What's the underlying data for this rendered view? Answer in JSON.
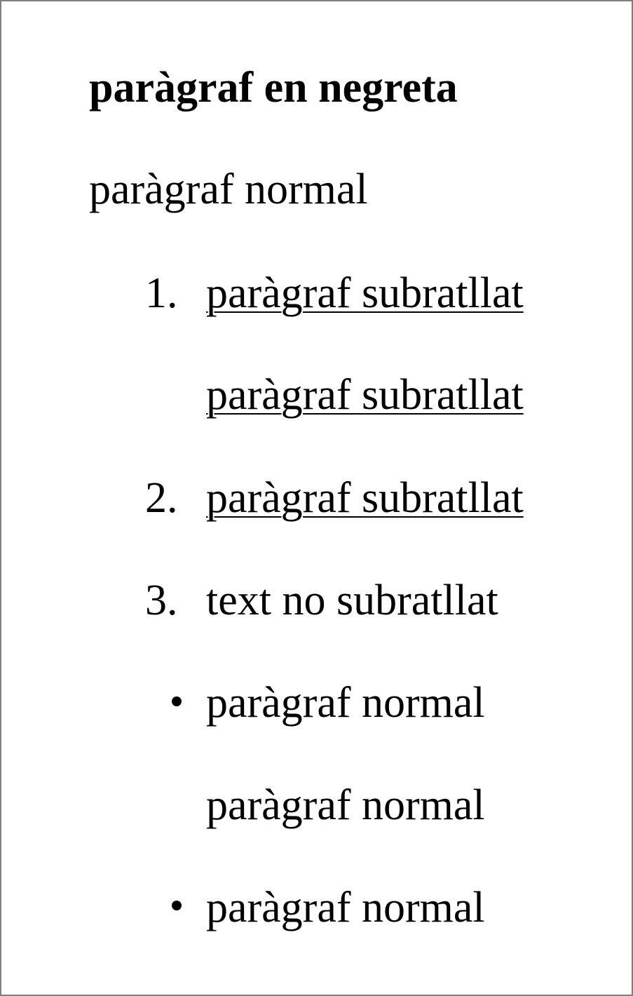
{
  "document": {
    "paragraphs": [
      {
        "text": "paràgraf en negreta",
        "bold": true
      },
      {
        "text": "paràgraf normal",
        "bold": false
      }
    ],
    "ordered_list": [
      {
        "marker": "1.",
        "lines": [
          "paràgraf subratllat",
          "paràgraf subratllat"
        ],
        "underline": true
      },
      {
        "marker": "2.",
        "lines": [
          "paràgraf subratllat"
        ],
        "underline": true
      },
      {
        "marker": "3.",
        "lines": [
          "text no subratllat"
        ],
        "underline": false
      }
    ],
    "bullet_list": [
      {
        "lines": [
          "paràgraf normal",
          "paràgraf normal"
        ]
      },
      {
        "lines": [
          "paràgraf normal"
        ]
      }
    ]
  }
}
